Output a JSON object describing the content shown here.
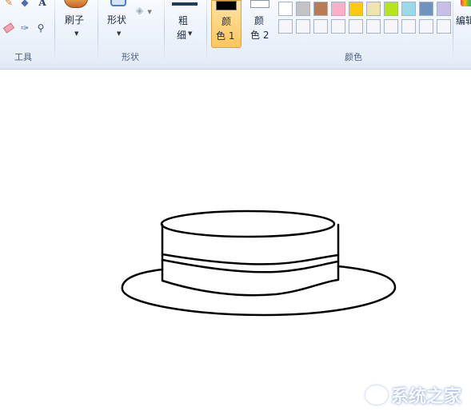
{
  "ribbon": {
    "tools_group_label": "工具",
    "brush_label": "刷子",
    "shapes_label": "形状",
    "shapes_group_label": "形状",
    "size_label_top": "粗",
    "size_label_bottom": "细",
    "color1_top": "颜",
    "color1_bottom": "色 1",
    "color2_top": "颜",
    "color2_bottom": "色 2",
    "colors_group_label": "颜色",
    "edit_colors_label": "编辑"
  },
  "icons": {
    "pencil": "pencil-icon",
    "fill": "fill-bucket-icon",
    "text": "text-icon",
    "eraser": "eraser-icon",
    "picker": "color-picker-icon",
    "magnifier": "magnifier-icon"
  },
  "palette_row1": [
    "#ffffff",
    "#c3c3c3",
    "#b97a57",
    "#ffaec9",
    "#ffc90e",
    "#efe4b0",
    "#b5e61d",
    "#99d9ea",
    "#7092be",
    "#c8bfe7"
  ],
  "palette_row2": [
    "#f4f6fa",
    "#f4f6fa",
    "#f4f6fa",
    "#f4f6fa",
    "#f4f6fa",
    "#f4f6fa",
    "#f4f6fa",
    "#f4f6fa",
    "#f4f6fa",
    "#f4f6fa"
  ],
  "colors": {
    "color1": "#000000",
    "color2": "#ffffff",
    "selected_bg": "#ffd98a"
  },
  "watermark": {
    "text": "系统之家"
  }
}
